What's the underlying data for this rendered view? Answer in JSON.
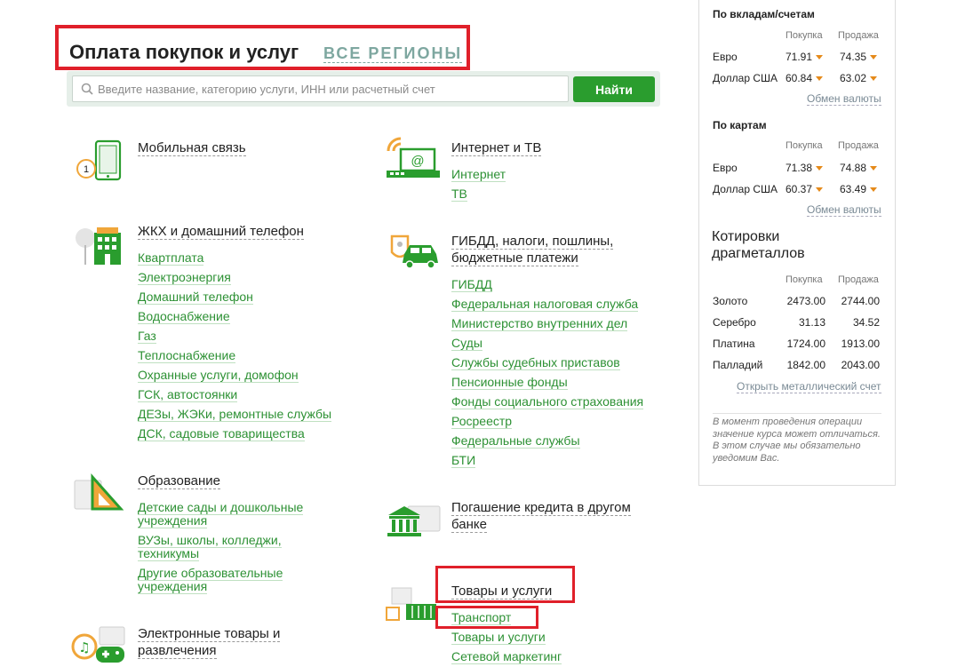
{
  "header": {
    "title": "Оплата покупок и услуг",
    "region": "ВСЕ РЕГИОНЫ"
  },
  "search": {
    "placeholder": "Введите название, категорию услуги, ИНН или расчетный счет",
    "button_label": "Найти"
  },
  "categories": {
    "mobile": {
      "title": "Мобильная связь",
      "icon": "mobile-phone-icon"
    },
    "internet": {
      "title": "Интернет и ТВ",
      "icon": "laptop-wifi-icon",
      "links": [
        "Интернет",
        "ТВ"
      ]
    },
    "housing": {
      "title": "ЖКХ и домашний телефон",
      "icon": "house-icon",
      "links": [
        "Квартплата",
        "Электроэнергия",
        "Домашний телефон",
        "Водоснабжение",
        "Газ",
        "Теплоснабжение",
        "Охранные услуги, домофон",
        "ГСК, автостоянки",
        "ДЕЗы, ЖЭКи, ремонтные службы",
        "ДСК, садовые товарищества"
      ]
    },
    "gibdd": {
      "title": "ГИБДД, налоги, пошлины, бюджетные платежи",
      "icon": "car-emblem-icon",
      "links": [
        "ГИБДД",
        "Федеральная налоговая служба",
        "Министерство внутренних дел",
        "Суды",
        "Службы судебных приставов",
        "Пенсионные фонды",
        "Фонды социального страхования",
        "Росреестр",
        "Федеральные службы",
        "БТИ"
      ]
    },
    "education": {
      "title": "Образование",
      "icon": "ruler-triangle-icon",
      "links": [
        "Детские сады и дошкольные учреждения",
        "ВУЗы, школы, колледжи, техникумы",
        "Другие образовательные учреждения"
      ]
    },
    "credit": {
      "title": "Погашение кредита в другом банке",
      "icon": "bank-icon"
    },
    "goods": {
      "title": "Товары и услуги",
      "icon": "shopping-basket-icon",
      "links": [
        "Транспорт",
        "Товары и услуги",
        "Сетевой маркетинг"
      ]
    },
    "entertainment": {
      "title": "Электронные товары и развлечения",
      "icon": "music-gamepad-icon"
    }
  },
  "rates": {
    "deposits_title": "По вкладам/счетам",
    "cards_title": "По картам",
    "buy_label": "Покупка",
    "sell_label": "Продажа",
    "deposits": [
      {
        "currency": "Евро",
        "buy": "71.91",
        "sell": "74.35"
      },
      {
        "currency": "Доллар США",
        "buy": "60.84",
        "sell": "63.02"
      }
    ],
    "cards": [
      {
        "currency": "Евро",
        "buy": "71.38",
        "sell": "74.88"
      },
      {
        "currency": "Доллар США",
        "buy": "60.37",
        "sell": "63.49"
      }
    ],
    "exchange_link": "Обмен валюты",
    "metals_title": "Котировки драгметаллов",
    "metals": [
      {
        "name": "Золото",
        "buy": "2473.00",
        "sell": "2744.00"
      },
      {
        "name": "Серебро",
        "buy": "31.13",
        "sell": "34.52"
      },
      {
        "name": "Платина",
        "buy": "1724.00",
        "sell": "1913.00"
      },
      {
        "name": "Палладий",
        "buy": "1842.00",
        "sell": "2043.00"
      }
    ],
    "metal_account_link": "Открыть металлический счет",
    "note": "В момент проведения операции значение курса может отличаться. В этом случае мы обязательно уведомим Вас."
  },
  "colors": {
    "accent_green": "#2a9d2e",
    "highlight_red": "#e0202a",
    "region_text": "#7ea7a0",
    "rate_down_arrow": "#e58a1a"
  }
}
